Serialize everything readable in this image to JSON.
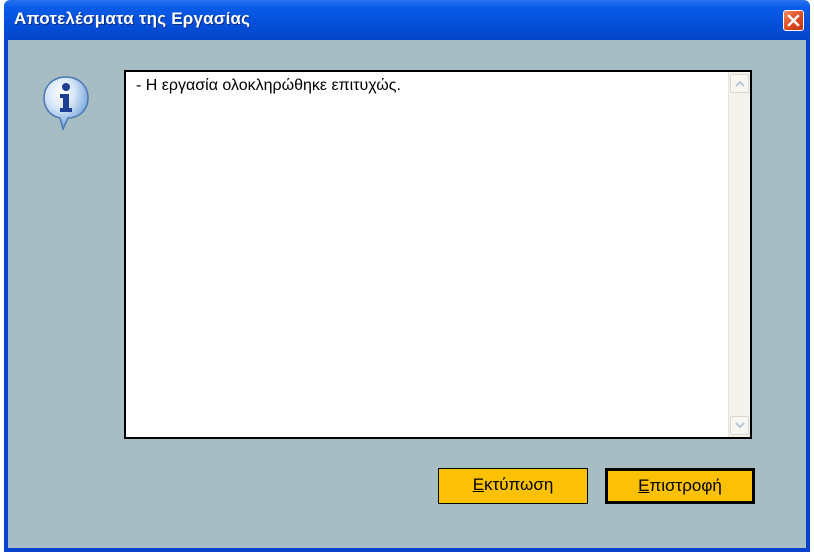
{
  "window": {
    "title": "Αποτελέσματα της Εργασίας"
  },
  "icons": {
    "info": "info-icon",
    "close": "close-icon",
    "scroll_up": "chevron-up-icon",
    "scroll_down": "chevron-down-icon"
  },
  "results": {
    "text": "- Η εργασία ολοκληρώθηκε επιτυχώς."
  },
  "buttons": {
    "print": {
      "accel": "Ε",
      "rest": "κτύπωση"
    },
    "return": {
      "accel": "Ε",
      "rest": "πιστροφή"
    }
  },
  "colors": {
    "titlebar": "#0450dc",
    "window_bg": "#a6bdc3",
    "button_bg": "#fcc004",
    "close_button": "#dc4a1e"
  }
}
